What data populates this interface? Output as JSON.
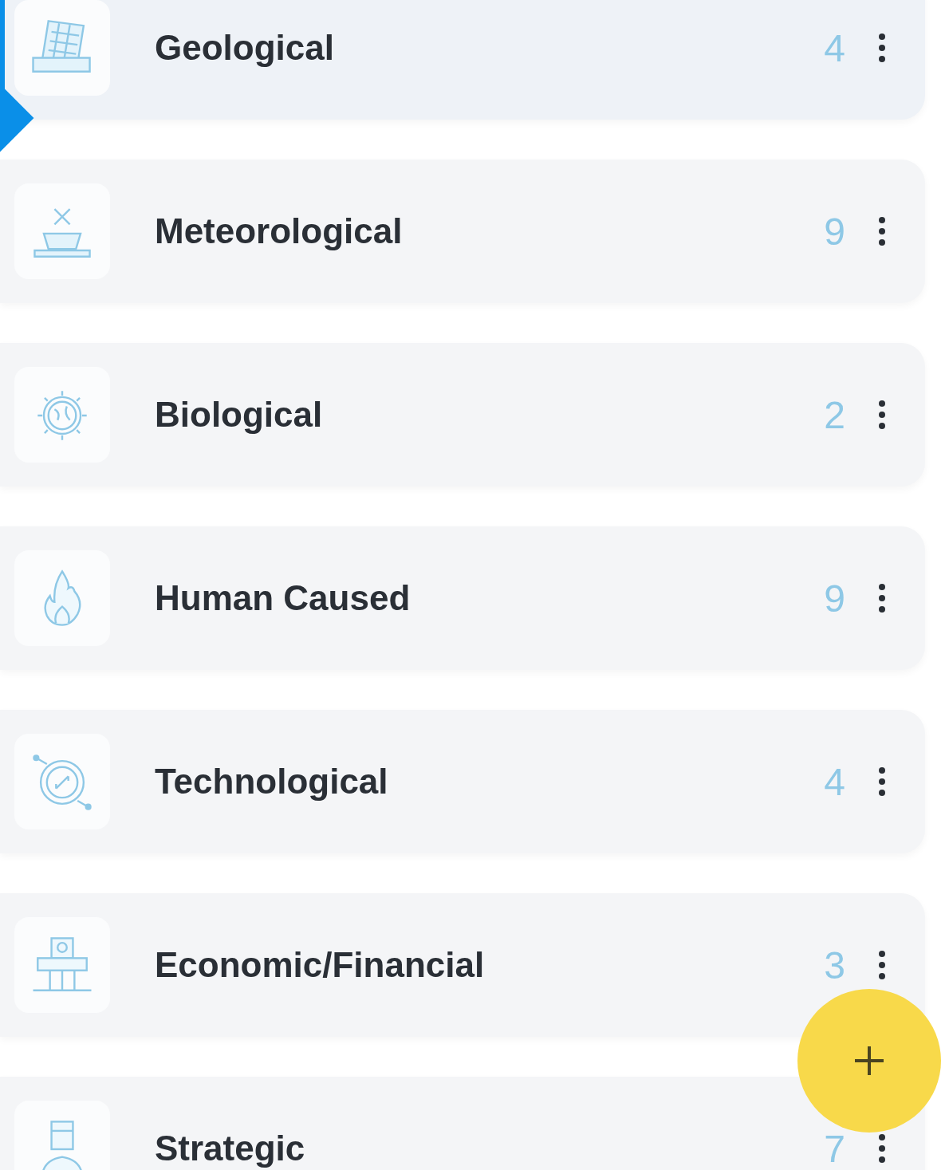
{
  "categories": [
    {
      "label": "Geological",
      "count": "4",
      "selected": true
    },
    {
      "label": "Meteorological",
      "count": "9",
      "selected": false
    },
    {
      "label": "Biological",
      "count": "2",
      "selected": false
    },
    {
      "label": "Human Caused",
      "count": "9",
      "selected": false
    },
    {
      "label": "Technological",
      "count": "4",
      "selected": false
    },
    {
      "label": "Economic/Financial",
      "count": "3",
      "selected": false
    },
    {
      "label": "Strategic",
      "count": "7",
      "selected": false
    }
  ]
}
